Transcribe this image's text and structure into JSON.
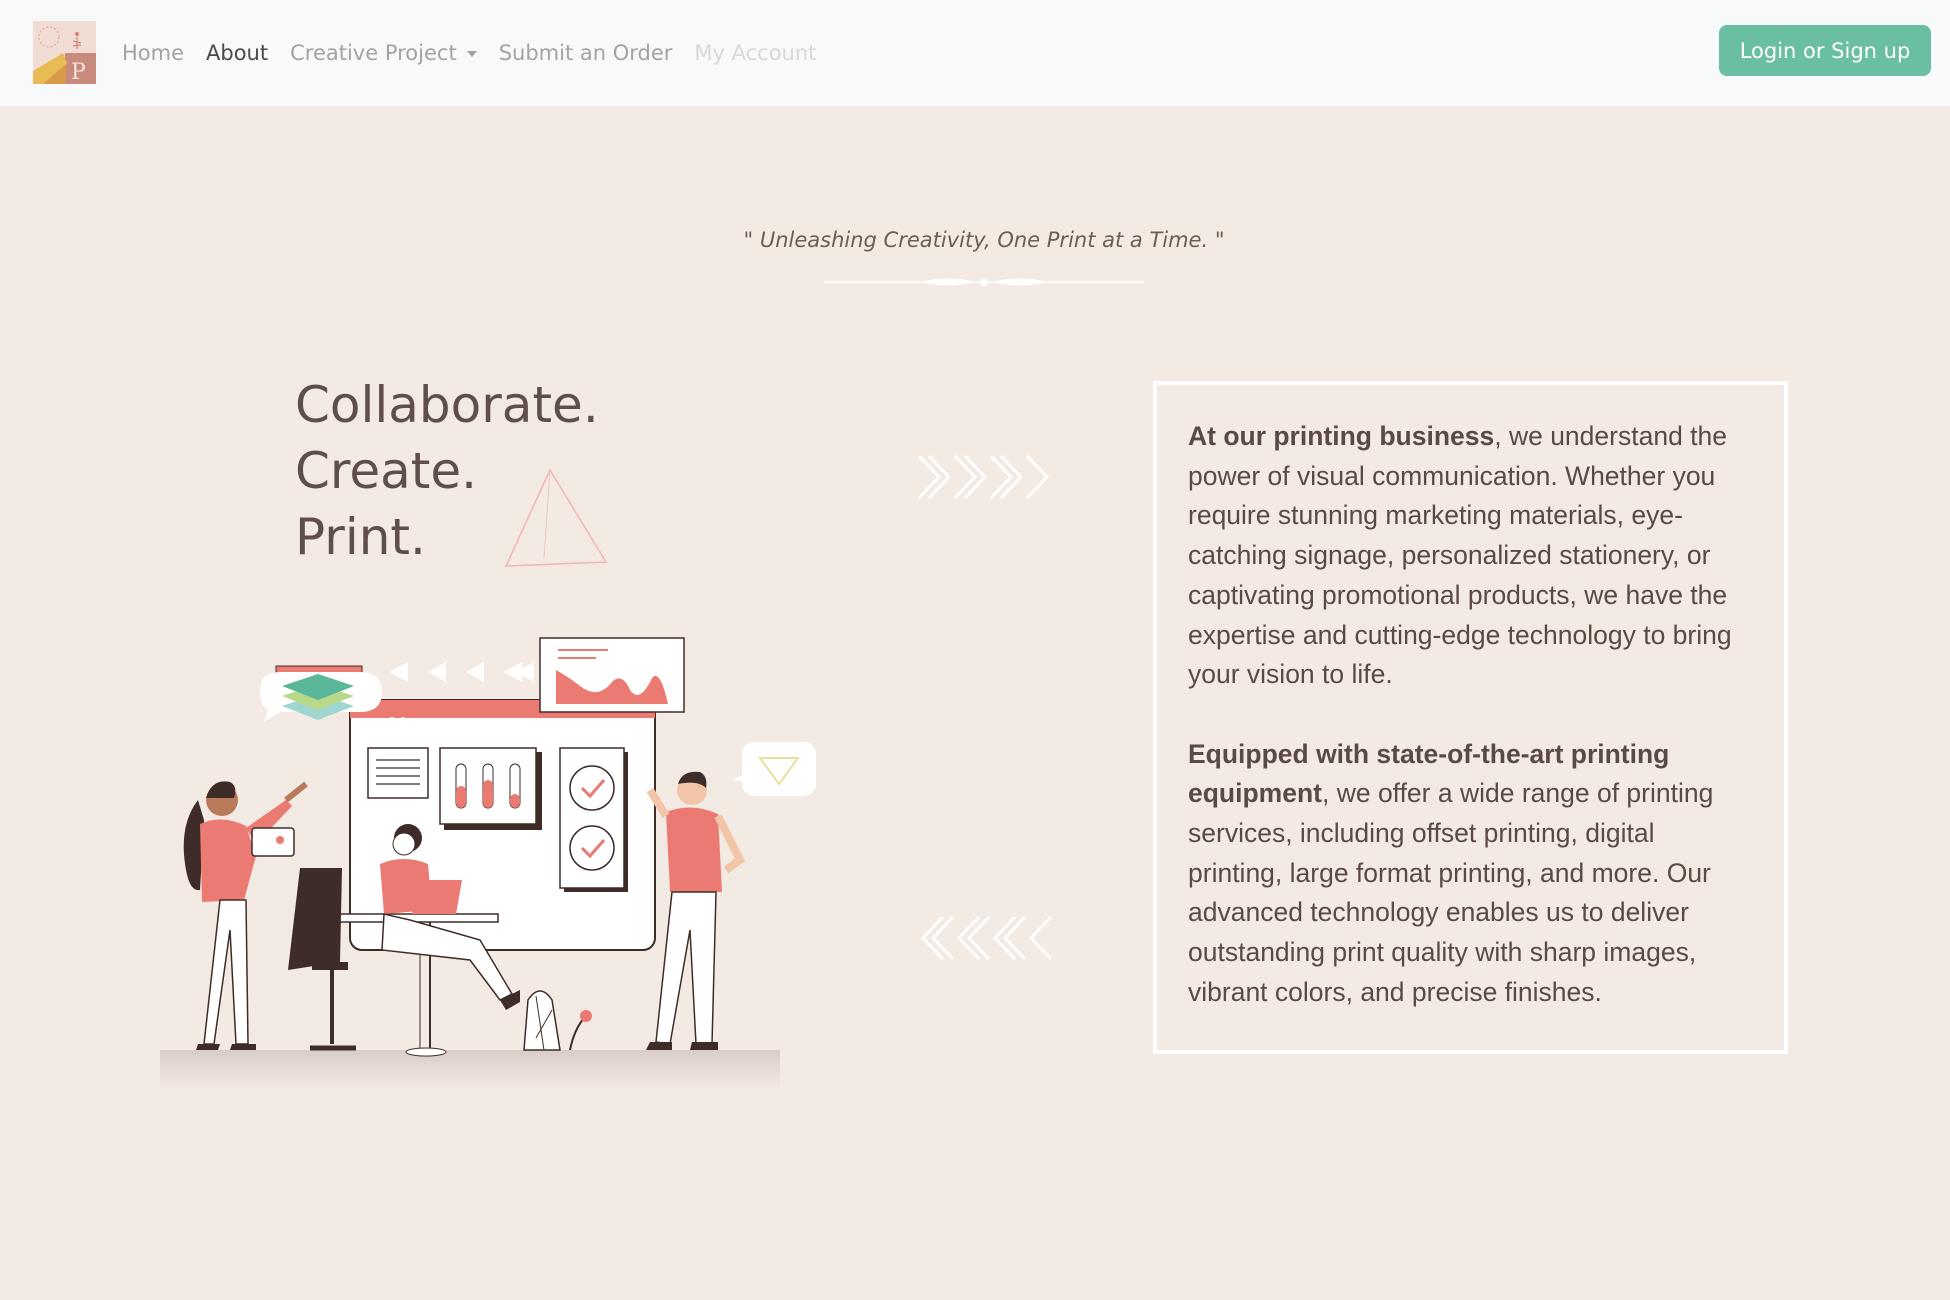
{
  "navbar": {
    "links": [
      {
        "label": "Home",
        "state": "normal"
      },
      {
        "label": "About",
        "state": "active"
      },
      {
        "label": "Creative Project",
        "state": "dropdown"
      },
      {
        "label": "Submit an Order",
        "state": "normal"
      },
      {
        "label": "My Account",
        "state": "disabled"
      }
    ],
    "login_label": "Login or Sign up"
  },
  "hero": {
    "quote": "\" Unleashing Creativity, One Print at a Time. \"",
    "headline": [
      "Collaborate.",
      "Create.",
      "Print."
    ]
  },
  "about": {
    "p1_bold": "At our printing business",
    "p1_rest": ", we understand the power of visual communication. Whether you require stunning marketing materials, eye-catching signage, personalized stationery, or captivating promotional products, we have the expertise and cutting-edge technology to bring your vision to life.",
    "p2_bold": "Equipped with state-of-the-art printing equipment",
    "p2_rest": ", we offer a wide range of printing services, including offset printing, digital printing, large format printing, and more. Our advanced technology enables us to deliver outstanding print quality with sharp images, vibrant colors, and precise finishes."
  },
  "colors": {
    "background": "#f4eae4",
    "navbar": "#f8f9fa",
    "accent_green": "#6bbfa1",
    "coral": "#ea7a72",
    "dark_brown": "#3e2c28"
  }
}
